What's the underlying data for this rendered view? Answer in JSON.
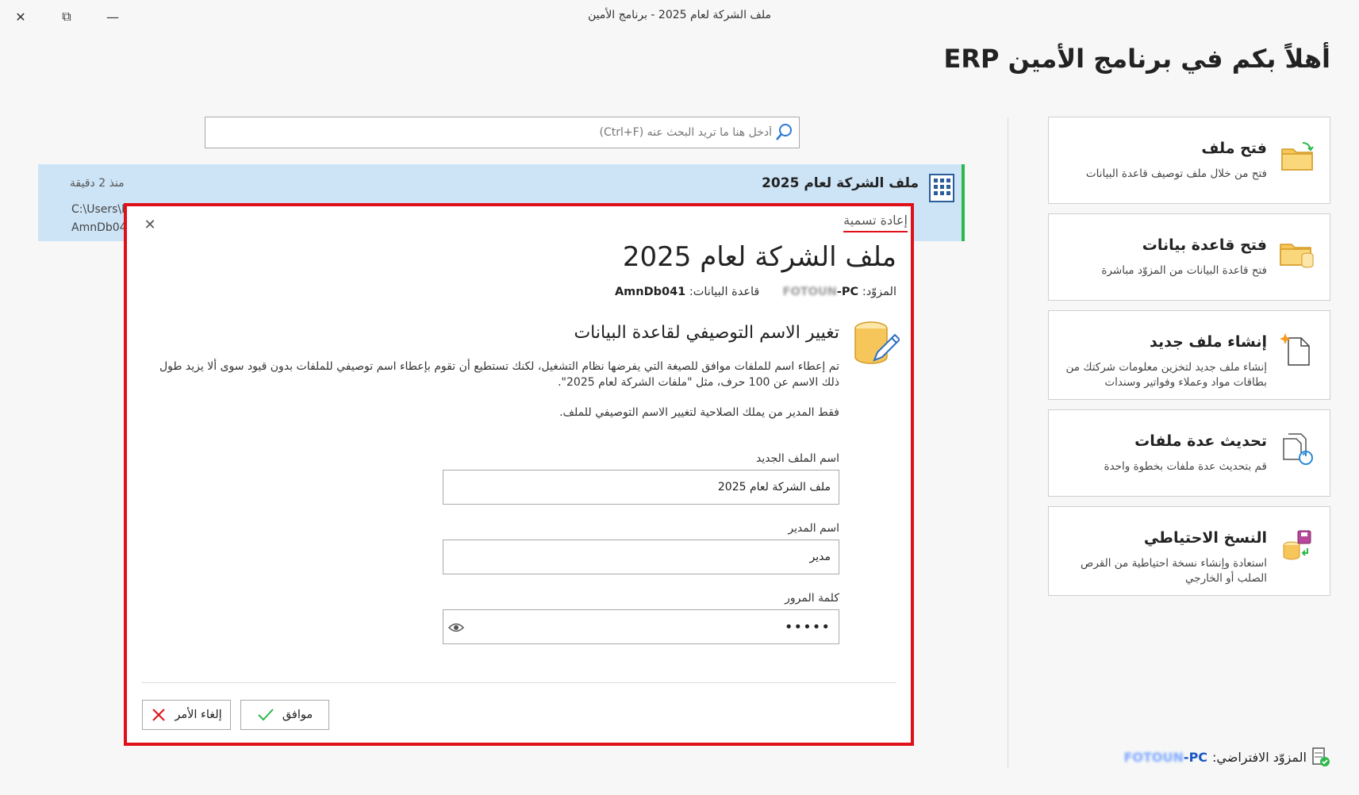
{
  "window": {
    "title": "ملف الشركة لعام 2025 - برنامج الأمين",
    "close_glyph": "✕",
    "restore_glyph": "⧉",
    "minimize_glyph": "—"
  },
  "welcome": "أهلاً بكم في برنامج الأمين ERP",
  "search": {
    "placeholder": "أدخل هنا ما تريد البحث عنه (Ctrl+F)"
  },
  "recent": {
    "title": "ملف الشركة لعام 2025",
    "time": "منذ 2 دقيقة",
    "path_line1": "C:\\Users\\F",
    "path_line2": "AmnDb04"
  },
  "actions": [
    {
      "title": "فتح ملف",
      "desc": "فتح من خلال ملف توصيف قاعدة البيانات",
      "icon": "open-folder-icon"
    },
    {
      "title": "فتح قاعدة بيانات",
      "desc": "فتح قاعدة البيانات من المزوّد مباشرة",
      "icon": "folder-database-icon"
    },
    {
      "title": "إنشاء ملف جديد",
      "desc": "إنشاء ملف جديد لتخزين معلومات شركتك من بطاقات مواد وعملاء وفواتير وسندات",
      "icon": "new-file-icon"
    },
    {
      "title": "تحديث عدة ملفات",
      "desc": "قم بتحديث عدة ملفات بخطوة واحدة",
      "icon": "update-files-icon"
    },
    {
      "title": "النسخ الاحتياطي",
      "desc": "استعادة وإنشاء نسخة احتياطية من القرص الصلب أو الخارجي",
      "icon": "backup-icon"
    }
  ],
  "default_provider": {
    "label": "المزوّد الافتراضي:",
    "pc_name_blurred": "FOTOUN",
    "pc_suffix": "-PC"
  },
  "dialog": {
    "tab": "إعادة تسمية",
    "close_glyph": "✕",
    "title": "ملف الشركة لعام 2025",
    "provider_label": "المزوّد:",
    "provider_blurred": "FOTOUN",
    "provider_suffix": "-PC",
    "database_label": "قاعدة البيانات:",
    "database_value": "AmnDb041",
    "heading": "تغيير الاسم التوصيفي لقاعدة البيانات",
    "description": "تم إعطاء اسم للملفات موافق للصيغة التي يفرضها نظام التشغيل، لكنك تستطيع أن تقوم بإعطاء اسم توصيفي للملفات بدون قيود سوى ألا يزيد طول ذلك الاسم عن 100 حرف، مثل \"ملفات الشركة لعام 2025\".",
    "note": "فقط المدير من يملك الصلاحية لتغيير الاسم التوصيفي للملف.",
    "fields": {
      "new_name_label": "اسم الملف الجديد",
      "new_name_value": "ملف الشركة لعام 2025",
      "manager_label": "اسم المدير",
      "manager_value": "مدير",
      "password_label": "كلمة المرور",
      "password_value": "•••••"
    },
    "ok_label": "موافق",
    "cancel_label": "إلغاء الأمر"
  },
  "colors": {
    "accent_red": "#e0101a",
    "selection_blue": "#cde4f7",
    "active_green": "#2db84b",
    "folder_yellow": "#f6c65b"
  }
}
